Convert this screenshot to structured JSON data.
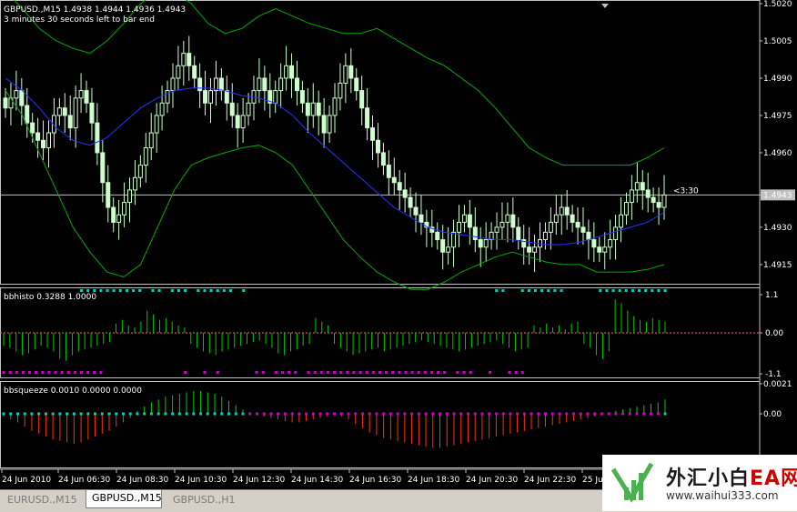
{
  "chart_data": [
    {
      "type": "candlestick",
      "title": "GBPUSD.,M15  1.4938 1.4944 1.4936 1.4943",
      "subtitle": "3 minutes 30 seconds left to bar end",
      "ylim": [
        1.4908,
        1.502
      ],
      "y_ticks": [
        "1.5020",
        "1.5005",
        "1.4990",
        "1.4975",
        "1.4960",
        "1.4943",
        "1.4930",
        "1.4915"
      ],
      "current_price": 1.4943,
      "countdown_label": "<3:30",
      "colors": {
        "candle": "#ccffcc",
        "bollinger_bands": "#00aa00",
        "moving_average": "#2233ff",
        "price_line": "#c0c0c0"
      },
      "candle_closes": [
        1.4978,
        1.4982,
        1.4985,
        1.4979,
        1.4972,
        1.4968,
        1.4965,
        1.4962,
        1.4968,
        1.4975,
        1.4978,
        1.4975,
        1.497,
        1.4982,
        1.4985,
        1.498,
        1.4972,
        1.496,
        1.4948,
        1.4938,
        1.4932,
        1.4935,
        1.494,
        1.4945,
        1.495,
        1.4955,
        1.4962,
        1.4968,
        1.4975,
        1.498,
        1.4985,
        1.499,
        1.4995,
        1.5,
        1.4995,
        1.499,
        1.4985,
        1.498,
        1.4985,
        1.499,
        1.4985,
        1.498,
        1.4975,
        1.497,
        1.4975,
        1.498,
        1.4985,
        1.499,
        1.4985,
        1.498,
        1.4985,
        1.499,
        1.4995,
        1.499,
        1.4985,
        1.498,
        1.4975,
        1.498,
        1.4975,
        1.4968,
        1.4975,
        1.4982,
        1.4988,
        1.4995,
        1.499,
        1.4985,
        1.4978,
        1.497,
        1.4965,
        1.496,
        1.4955,
        1.495,
        1.4948,
        1.4945,
        1.4942,
        1.4938,
        1.4935,
        1.4932,
        1.493,
        1.4928,
        1.4925,
        1.492,
        1.4922,
        1.4928,
        1.4932,
        1.4935,
        1.493,
        1.4925,
        1.4922,
        1.4925,
        1.4928,
        1.493,
        1.4932,
        1.4935,
        1.493,
        1.4925,
        1.4922,
        1.492,
        1.4922,
        1.4925,
        1.4928,
        1.4932,
        1.4935,
        1.4938,
        1.4935,
        1.4932,
        1.493,
        1.4928,
        1.4925,
        1.4922,
        1.492,
        1.4922,
        1.4925,
        1.493,
        1.4935,
        1.494,
        1.4945,
        1.4948,
        1.4945,
        1.4942,
        1.494,
        1.4938,
        1.4943
      ],
      "upper_band": [
        1.5025,
        1.5018,
        1.501,
        1.5005,
        1.5002,
        1.5,
        1.5005,
        1.5012,
        1.502,
        1.5025,
        1.5025,
        1.502,
        1.5012,
        1.5008,
        1.501,
        1.5015,
        1.5018,
        1.5015,
        1.5012,
        1.501,
        1.5008,
        1.5008,
        1.501,
        1.5006,
        1.5002,
        1.4998,
        1.4995,
        1.499,
        1.4985,
        1.4978,
        1.497,
        1.4962,
        1.4958,
        1.4955,
        1.4955,
        1.4955,
        1.4955,
        1.4955,
        1.4958,
        1.4962
      ],
      "lower_band": [
        1.4985,
        1.4975,
        1.496,
        1.4945,
        1.493,
        1.492,
        1.4912,
        1.491,
        1.4915,
        1.493,
        1.4945,
        1.4955,
        1.4958,
        1.496,
        1.4962,
        1.4963,
        1.496,
        1.4955,
        1.4945,
        1.4935,
        1.4925,
        1.4918,
        1.4912,
        1.4908,
        1.4905,
        1.4905,
        1.4908,
        1.4912,
        1.4915,
        1.4918,
        1.492,
        1.4918,
        1.4916,
        1.4915,
        1.4915,
        1.4912,
        1.4912,
        1.4912,
        1.4913,
        1.4915
      ],
      "moving_average": [
        1.499,
        1.4985,
        1.4978,
        1.497,
        1.4965,
        1.4963,
        1.4966,
        1.4972,
        1.4978,
        1.4982,
        1.4985,
        1.4986,
        1.4986,
        1.4985,
        1.4983,
        1.4982,
        1.498,
        1.4975,
        1.4968,
        1.4962,
        1.4956,
        1.495,
        1.4944,
        1.4938,
        1.4934,
        1.493,
        1.4928,
        1.4927,
        1.4926,
        1.4925,
        1.4925,
        1.4924,
        1.4923,
        1.4923,
        1.4924,
        1.4926,
        1.4928,
        1.493,
        1.4932,
        1.4936
      ]
    },
    {
      "type": "bar",
      "title": "bbhisto 0.3288 1.0000",
      "ylim": [
        -1.1,
        1.1
      ],
      "y_ticks": [
        "1.1",
        "0.00",
        "-1.1"
      ],
      "colors": {
        "bars": "#00cc00",
        "dots_top": "#00cccc",
        "dots_bottom": "#cc00cc",
        "zero_line": "#ff6666"
      },
      "values": [
        -0.35,
        -0.4,
        -0.5,
        -0.6,
        -0.55,
        -0.45,
        -0.35,
        -0.4,
        -0.5,
        -0.7,
        -0.75,
        -0.6,
        -0.5,
        -0.45,
        -0.4,
        -0.35,
        -0.3,
        -0.25,
        0.25,
        0.35,
        0.2,
        0.15,
        0.3,
        0.6,
        0.5,
        0.35,
        0.4,
        0.3,
        0.2,
        0.15,
        -0.3,
        -0.4,
        -0.5,
        -0.55,
        -0.6,
        -0.5,
        -0.45,
        -0.4,
        -0.35,
        -0.3,
        -0.25,
        -0.2,
        -0.3,
        -0.4,
        -0.55,
        -0.6,
        -0.5,
        -0.45,
        -0.35,
        -0.3,
        0.4,
        0.3,
        0.2,
        -0.3,
        -0.4,
        -0.5,
        -0.6,
        -0.55,
        -0.5,
        -0.45,
        -0.4,
        -0.5,
        -0.45,
        -0.4,
        -0.35,
        -0.3,
        -0.25,
        -0.2,
        -0.25,
        -0.3,
        -0.35,
        -0.4,
        -0.45,
        -0.5,
        -0.45,
        -0.4,
        -0.35,
        -0.3,
        -0.25,
        -0.2,
        -0.3,
        -0.4,
        -0.5,
        -0.45,
        -0.4,
        0.2,
        0.15,
        0.25,
        0.15,
        0.2,
        0.1,
        0.25,
        0.3,
        -0.3,
        -0.4,
        -0.6,
        -0.7,
        -0.5,
        0.9,
        0.8,
        0.6,
        0.45,
        0.35,
        0.3,
        0.4,
        0.35,
        0.3
      ],
      "dots_top": [
        0,
        0,
        0,
        0,
        0,
        0,
        0,
        0,
        0,
        0,
        0,
        0,
        1,
        1,
        1,
        1,
        1,
        1,
        1,
        1,
        1,
        1,
        0,
        1,
        1,
        0,
        1,
        1,
        1,
        0,
        1,
        1,
        1,
        1,
        1,
        1,
        0,
        1,
        0,
        0,
        0,
        0,
        0,
        0,
        0,
        0,
        0,
        0,
        0,
        0,
        0,
        0,
        0,
        0,
        0,
        0,
        0,
        0,
        0,
        0,
        0,
        0,
        0,
        0,
        0,
        0,
        0,
        0,
        0,
        0,
        0,
        0,
        0,
        0,
        0,
        0,
        1,
        1,
        0,
        0,
        1,
        1,
        1,
        1,
        1,
        1,
        1,
        0,
        0,
        0,
        0,
        0,
        1,
        1,
        1,
        1,
        1,
        1,
        1,
        1,
        1,
        1,
        1
      ],
      "dots_bottom": [
        1,
        1,
        1,
        1,
        1,
        1,
        1,
        1,
        1,
        1,
        1,
        1,
        1,
        1,
        1,
        1,
        0,
        0,
        0,
        0,
        0,
        0,
        0,
        0,
        0,
        0,
        0,
        0,
        1,
        0,
        0,
        1,
        0,
        1,
        0,
        0,
        0,
        0,
        0,
        1,
        1,
        0,
        1,
        1,
        1,
        1,
        0,
        1,
        1,
        1,
        1,
        1,
        1,
        1,
        1,
        1,
        1,
        1,
        1,
        1,
        1,
        1,
        1,
        1,
        1,
        1,
        1,
        1,
        1,
        0,
        1,
        1,
        1,
        0,
        0,
        1,
        0,
        0,
        1,
        1,
        1,
        0,
        0,
        0,
        0,
        0,
        0,
        0,
        0,
        0,
        0,
        0,
        0,
        0,
        0,
        0,
        0,
        0,
        0,
        0,
        0,
        0,
        0
      ]
    },
    {
      "type": "bar",
      "title": "bbsqueeze 0.0010 0.0000 0.0000",
      "ylim": [
        -0.0028,
        0.0021
      ],
      "y_ticks": [
        "0.0021",
        "0.00"
      ],
      "colors": {
        "positive": "#00cc00",
        "negative": "#ff3300",
        "dots_cyan": "#00cccc",
        "dots_magenta": "#cc00cc"
      },
      "values": [
        -0.0002,
        -0.0004,
        -0.0006,
        -0.0009,
        -0.0012,
        -0.0014,
        -0.0016,
        -0.0018,
        -0.0019,
        -0.002,
        -0.0021,
        -0.002,
        -0.0018,
        -0.0016,
        -0.0014,
        -0.0012,
        -0.0009,
        -0.0006,
        -0.0003,
        0.0002,
        0.0005,
        0.0008,
        0.001,
        0.0012,
        0.0013,
        0.0014,
        0.0015,
        0.0016,
        0.0016,
        0.0015,
        0.0014,
        0.0012,
        0.0009,
        0.0006,
        0.0003,
        0.0001,
        -0.0001,
        -0.0002,
        -0.0003,
        -0.0004,
        -0.0005,
        -0.0006,
        -0.0006,
        -0.0005,
        -0.0004,
        -0.0003,
        -0.0002,
        -0.0001,
        -0.0002,
        -0.0004,
        -0.0007,
        -0.001,
        -0.0013,
        -0.0015,
        -0.0017,
        -0.0018,
        -0.0019,
        -0.002,
        -0.0021,
        -0.0022,
        -0.0023,
        -0.0024,
        -0.0024,
        -0.0023,
        -0.0022,
        -0.0021,
        -0.002,
        -0.0019,
        -0.0018,
        -0.0017,
        -0.0016,
        -0.0015,
        -0.0014,
        -0.0013,
        -0.0012,
        -0.0011,
        -0.001,
        -0.0009,
        -0.0008,
        -0.0007,
        -0.0006,
        -0.0005,
        -0.0004,
        -0.0003,
        -0.0002,
        -0.0001,
        0.0001,
        0.0002,
        0.0003,
        0.0004,
        0.0005,
        0.0006,
        0.0007,
        0.0008,
        0.001
      ],
      "dot_color_flags": [
        0,
        0,
        0,
        0,
        0,
        0,
        0,
        0,
        0,
        0,
        0,
        0,
        0,
        0,
        0,
        0,
        0,
        0,
        0,
        0,
        0,
        0,
        0,
        0,
        0,
        0,
        0,
        0,
        0,
        0,
        0,
        0,
        0,
        0,
        0,
        1,
        1,
        1,
        1,
        1,
        1,
        1,
        1,
        1,
        1,
        1,
        1,
        1,
        1,
        1,
        1,
        1,
        1,
        1,
        1,
        1,
        1,
        1,
        1,
        1,
        1,
        1,
        1,
        1,
        1,
        1,
        1,
        1,
        1,
        1,
        1,
        1,
        1,
        1,
        1,
        1,
        1,
        1,
        1,
        1,
        1,
        1,
        1,
        1,
        1,
        1,
        1,
        1,
        1,
        1,
        1,
        1,
        1,
        1,
        0
      ]
    }
  ],
  "x_axis": {
    "labels": [
      "24 Jun 2010",
      "24 Jun 06:30",
      "24 Jun 08:30",
      "24 Jun 10:30",
      "24 Jun 12:30",
      "24 Jun 14:30",
      "24 Jun 16:30",
      "24 Jun 18:30",
      "24 Jun 20:30",
      "24 Jun 22:30",
      "25 Jun"
    ]
  },
  "tabs": [
    "EURUSD.,M15",
    "GBPUSD.,M15",
    "GBPUSD.,H1"
  ],
  "active_tab": 1,
  "logo": {
    "cn_text": "外汇小白",
    "ea_text": "EA网",
    "url": "www.waihui333.com"
  }
}
